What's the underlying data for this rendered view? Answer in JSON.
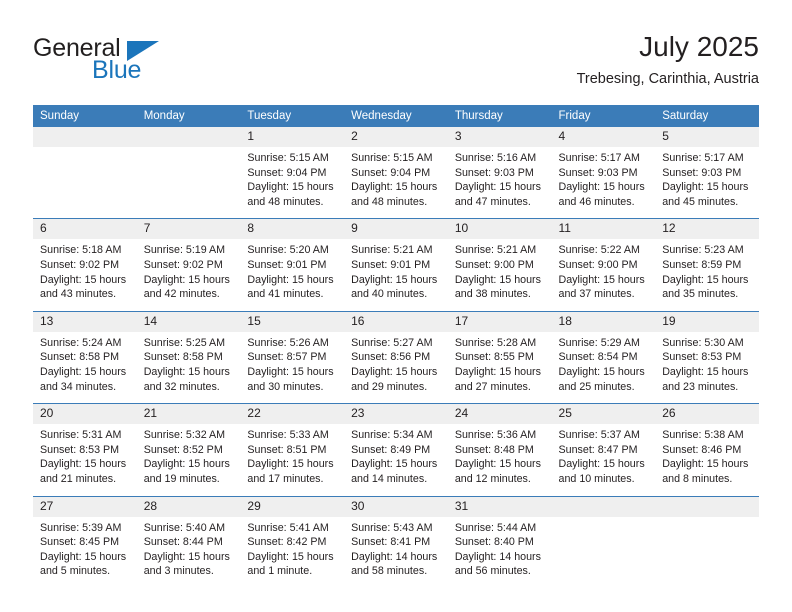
{
  "logo": {
    "word1": "General",
    "word2": "Blue",
    "accent_color": "#1b75bb",
    "triangle_icon": "triangle-icon"
  },
  "header": {
    "title": "July 2025",
    "subtitle": "Trebesing, Carinthia, Austria"
  },
  "calendar": {
    "header_bg": "#3b7cb8",
    "daynum_bg": "#efefef",
    "weekday_headers": [
      "Sunday",
      "Monday",
      "Tuesday",
      "Wednesday",
      "Thursday",
      "Friday",
      "Saturday"
    ],
    "weeks": [
      [
        {
          "day": "",
          "sunrise": "",
          "sunset": "",
          "daylight1": "",
          "daylight2": ""
        },
        {
          "day": "",
          "sunrise": "",
          "sunset": "",
          "daylight1": "",
          "daylight2": ""
        },
        {
          "day": "1",
          "sunrise": "Sunrise: 5:15 AM",
          "sunset": "Sunset: 9:04 PM",
          "daylight1": "Daylight: 15 hours",
          "daylight2": "and 48 minutes."
        },
        {
          "day": "2",
          "sunrise": "Sunrise: 5:15 AM",
          "sunset": "Sunset: 9:04 PM",
          "daylight1": "Daylight: 15 hours",
          "daylight2": "and 48 minutes."
        },
        {
          "day": "3",
          "sunrise": "Sunrise: 5:16 AM",
          "sunset": "Sunset: 9:03 PM",
          "daylight1": "Daylight: 15 hours",
          "daylight2": "and 47 minutes."
        },
        {
          "day": "4",
          "sunrise": "Sunrise: 5:17 AM",
          "sunset": "Sunset: 9:03 PM",
          "daylight1": "Daylight: 15 hours",
          "daylight2": "and 46 minutes."
        },
        {
          "day": "5",
          "sunrise": "Sunrise: 5:17 AM",
          "sunset": "Sunset: 9:03 PM",
          "daylight1": "Daylight: 15 hours",
          "daylight2": "and 45 minutes."
        }
      ],
      [
        {
          "day": "6",
          "sunrise": "Sunrise: 5:18 AM",
          "sunset": "Sunset: 9:02 PM",
          "daylight1": "Daylight: 15 hours",
          "daylight2": "and 43 minutes."
        },
        {
          "day": "7",
          "sunrise": "Sunrise: 5:19 AM",
          "sunset": "Sunset: 9:02 PM",
          "daylight1": "Daylight: 15 hours",
          "daylight2": "and 42 minutes."
        },
        {
          "day": "8",
          "sunrise": "Sunrise: 5:20 AM",
          "sunset": "Sunset: 9:01 PM",
          "daylight1": "Daylight: 15 hours",
          "daylight2": "and 41 minutes."
        },
        {
          "day": "9",
          "sunrise": "Sunrise: 5:21 AM",
          "sunset": "Sunset: 9:01 PM",
          "daylight1": "Daylight: 15 hours",
          "daylight2": "and 40 minutes."
        },
        {
          "day": "10",
          "sunrise": "Sunrise: 5:21 AM",
          "sunset": "Sunset: 9:00 PM",
          "daylight1": "Daylight: 15 hours",
          "daylight2": "and 38 minutes."
        },
        {
          "day": "11",
          "sunrise": "Sunrise: 5:22 AM",
          "sunset": "Sunset: 9:00 PM",
          "daylight1": "Daylight: 15 hours",
          "daylight2": "and 37 minutes."
        },
        {
          "day": "12",
          "sunrise": "Sunrise: 5:23 AM",
          "sunset": "Sunset: 8:59 PM",
          "daylight1": "Daylight: 15 hours",
          "daylight2": "and 35 minutes."
        }
      ],
      [
        {
          "day": "13",
          "sunrise": "Sunrise: 5:24 AM",
          "sunset": "Sunset: 8:58 PM",
          "daylight1": "Daylight: 15 hours",
          "daylight2": "and 34 minutes."
        },
        {
          "day": "14",
          "sunrise": "Sunrise: 5:25 AM",
          "sunset": "Sunset: 8:58 PM",
          "daylight1": "Daylight: 15 hours",
          "daylight2": "and 32 minutes."
        },
        {
          "day": "15",
          "sunrise": "Sunrise: 5:26 AM",
          "sunset": "Sunset: 8:57 PM",
          "daylight1": "Daylight: 15 hours",
          "daylight2": "and 30 minutes."
        },
        {
          "day": "16",
          "sunrise": "Sunrise: 5:27 AM",
          "sunset": "Sunset: 8:56 PM",
          "daylight1": "Daylight: 15 hours",
          "daylight2": "and 29 minutes."
        },
        {
          "day": "17",
          "sunrise": "Sunrise: 5:28 AM",
          "sunset": "Sunset: 8:55 PM",
          "daylight1": "Daylight: 15 hours",
          "daylight2": "and 27 minutes."
        },
        {
          "day": "18",
          "sunrise": "Sunrise: 5:29 AM",
          "sunset": "Sunset: 8:54 PM",
          "daylight1": "Daylight: 15 hours",
          "daylight2": "and 25 minutes."
        },
        {
          "day": "19",
          "sunrise": "Sunrise: 5:30 AM",
          "sunset": "Sunset: 8:53 PM",
          "daylight1": "Daylight: 15 hours",
          "daylight2": "and 23 minutes."
        }
      ],
      [
        {
          "day": "20",
          "sunrise": "Sunrise: 5:31 AM",
          "sunset": "Sunset: 8:53 PM",
          "daylight1": "Daylight: 15 hours",
          "daylight2": "and 21 minutes."
        },
        {
          "day": "21",
          "sunrise": "Sunrise: 5:32 AM",
          "sunset": "Sunset: 8:52 PM",
          "daylight1": "Daylight: 15 hours",
          "daylight2": "and 19 minutes."
        },
        {
          "day": "22",
          "sunrise": "Sunrise: 5:33 AM",
          "sunset": "Sunset: 8:51 PM",
          "daylight1": "Daylight: 15 hours",
          "daylight2": "and 17 minutes."
        },
        {
          "day": "23",
          "sunrise": "Sunrise: 5:34 AM",
          "sunset": "Sunset: 8:49 PM",
          "daylight1": "Daylight: 15 hours",
          "daylight2": "and 14 minutes."
        },
        {
          "day": "24",
          "sunrise": "Sunrise: 5:36 AM",
          "sunset": "Sunset: 8:48 PM",
          "daylight1": "Daylight: 15 hours",
          "daylight2": "and 12 minutes."
        },
        {
          "day": "25",
          "sunrise": "Sunrise: 5:37 AM",
          "sunset": "Sunset: 8:47 PM",
          "daylight1": "Daylight: 15 hours",
          "daylight2": "and 10 minutes."
        },
        {
          "day": "26",
          "sunrise": "Sunrise: 5:38 AM",
          "sunset": "Sunset: 8:46 PM",
          "daylight1": "Daylight: 15 hours",
          "daylight2": "and 8 minutes."
        }
      ],
      [
        {
          "day": "27",
          "sunrise": "Sunrise: 5:39 AM",
          "sunset": "Sunset: 8:45 PM",
          "daylight1": "Daylight: 15 hours",
          "daylight2": "and 5 minutes."
        },
        {
          "day": "28",
          "sunrise": "Sunrise: 5:40 AM",
          "sunset": "Sunset: 8:44 PM",
          "daylight1": "Daylight: 15 hours",
          "daylight2": "and 3 minutes."
        },
        {
          "day": "29",
          "sunrise": "Sunrise: 5:41 AM",
          "sunset": "Sunset: 8:42 PM",
          "daylight1": "Daylight: 15 hours",
          "daylight2": "and 1 minute."
        },
        {
          "day": "30",
          "sunrise": "Sunrise: 5:43 AM",
          "sunset": "Sunset: 8:41 PM",
          "daylight1": "Daylight: 14 hours",
          "daylight2": "and 58 minutes."
        },
        {
          "day": "31",
          "sunrise": "Sunrise: 5:44 AM",
          "sunset": "Sunset: 8:40 PM",
          "daylight1": "Daylight: 14 hours",
          "daylight2": "and 56 minutes."
        },
        {
          "day": "",
          "sunrise": "",
          "sunset": "",
          "daylight1": "",
          "daylight2": ""
        },
        {
          "day": "",
          "sunrise": "",
          "sunset": "",
          "daylight1": "",
          "daylight2": ""
        }
      ]
    ]
  }
}
